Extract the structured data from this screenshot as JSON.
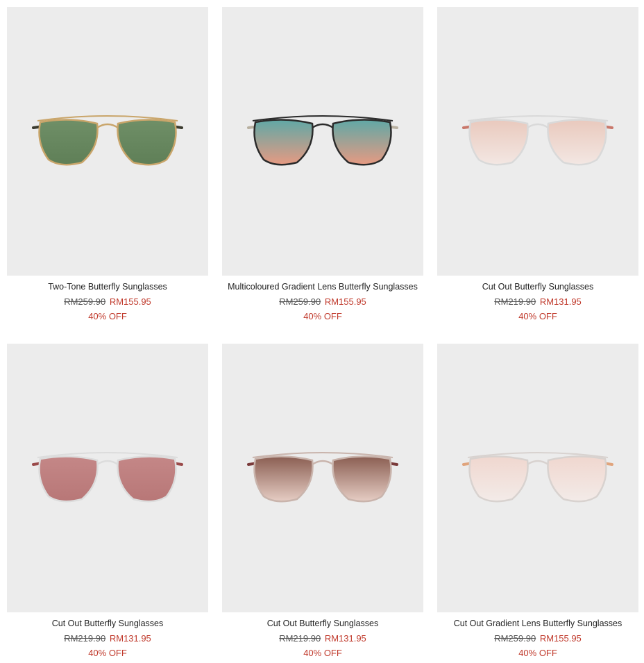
{
  "products": [
    {
      "name": "Two-Tone Butterfly Sunglasses",
      "old_price": "RM259.90",
      "new_price": "RM155.95",
      "discount": "40% OFF",
      "lens_top": "#6f8f67",
      "lens_bottom": "#5f7f57",
      "frame": "#c9a56a",
      "temple": "#3a3a2e"
    },
    {
      "name": "Multicoloured Gradient Lens Butterfly Sunglasses",
      "old_price": "RM259.90",
      "new_price": "RM155.95",
      "discount": "40% OFF",
      "lens_top": "#5fa8a6",
      "lens_bottom": "#e79a82",
      "frame": "#2b2b2b",
      "temple": "#b8b0a0"
    },
    {
      "name": "Cut Out Butterfly Sunglasses",
      "old_price": "RM219.90",
      "new_price": "RM131.95",
      "discount": "40% OFF",
      "lens_top": "#e9c9bd",
      "lens_bottom": "#f3e7e3",
      "frame": "#d9d9d9",
      "temple": "#c9776a"
    },
    {
      "name": "Cut Out Butterfly Sunglasses",
      "old_price": "RM219.90",
      "new_price": "RM131.95",
      "discount": "40% OFF",
      "lens_top": "#c48787",
      "lens_bottom": "#b87777",
      "frame": "#dcdcdc",
      "temple": "#9a4a4a"
    },
    {
      "name": "Cut Out Butterfly Sunglasses",
      "old_price": "RM219.90",
      "new_price": "RM131.95",
      "discount": "40% OFF",
      "lens_top": "#8a5e52",
      "lens_bottom": "#e6cdc4",
      "frame": "#c9b4ac",
      "temple": "#7a3a3a"
    },
    {
      "name": "Cut Out Gradient Lens Butterfly Sunglasses",
      "old_price": "RM259.90",
      "new_price": "RM155.95",
      "discount": "40% OFF",
      "lens_top": "#f0d7cf",
      "lens_bottom": "#f3ebe8",
      "frame": "#d8d2cf",
      "temple": "#e0a47c"
    }
  ]
}
